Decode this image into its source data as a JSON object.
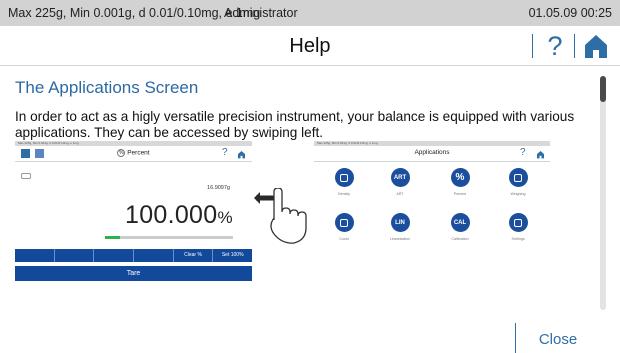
{
  "status_bar": {
    "balance_info": "Max 225g, Min 0.001g, d 0.01/0.10mg, e 1mg",
    "user": "Administrator",
    "datetime": "01.05.09 00:25"
  },
  "header": {
    "title": "Help",
    "help_label": "?",
    "help_icon": "question-icon",
    "home_icon": "home-icon"
  },
  "content": {
    "heading": "The Applications Screen",
    "paragraph": "In order to act as a higly versatile precision instrument, your balance is equipped with various applications. They can be accessed by swiping left."
  },
  "figure": {
    "left_screen": {
      "status_text": "Max 225g, Min 0.001g, d 0.01/0.10mg, e 1mg",
      "title": "Percent",
      "small_weight": "16.9097g",
      "weight_value": "100.000",
      "weight_unit": "%",
      "progress_fraction": 0.12,
      "softkeys": [
        "",
        "",
        "",
        "",
        "Clear %",
        "Set 100%"
      ],
      "tare_label": "Tare"
    },
    "right_screen": {
      "status_text": "Max 225g, Min 0.001g, d 0.01/0.10mg, e 1mg",
      "title": "Applications",
      "apps": [
        {
          "name": "Density",
          "icon": "density-icon",
          "glyph": ""
        },
        {
          "name": "ART",
          "icon": "art-icon",
          "glyph": "ART"
        },
        {
          "name": "Percent",
          "icon": "percent-icon",
          "glyph": "%"
        },
        {
          "name": "Weighing",
          "icon": "scale-icon",
          "glyph": ""
        },
        {
          "name": "Count",
          "icon": "count-icon",
          "glyph": ""
        },
        {
          "name": "Linearization",
          "icon": "lin-icon",
          "glyph": "LIN"
        },
        {
          "name": "Calibration",
          "icon": "cal-icon",
          "glyph": "CAL"
        },
        {
          "name": "Settings",
          "icon": "settings-icon",
          "glyph": ""
        }
      ]
    },
    "gesture_icon": "swipe-left-hand-icon"
  },
  "footer": {
    "close_label": "Close"
  },
  "colors": {
    "accent": "#2e6ea6",
    "softkey_blue": "#12499b",
    "status_bar": "#d2d2d2"
  }
}
